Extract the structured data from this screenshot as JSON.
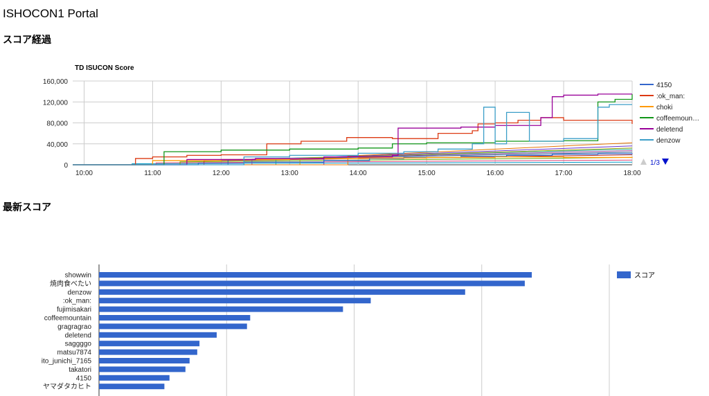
{
  "page": {
    "title": "ISHOCON1 Portal",
    "history_heading": "スコア経過",
    "latest_heading": "最新スコア"
  },
  "chart_data": [
    {
      "type": "line",
      "title": "TD ISUCON Score",
      "x_ticks": [
        "10:00",
        "11:00",
        "12:00",
        "13:00",
        "14:00",
        "15:00",
        "16:00",
        "17:00",
        "18:00"
      ],
      "xlim": [
        "09:50",
        "18:00"
      ],
      "ylim": [
        0,
        160000
      ],
      "y_ticks": [
        0,
        40000,
        80000,
        120000,
        160000
      ],
      "y_tick_labels": [
        "0",
        "40,000",
        "80,000",
        "120,000",
        "160,000"
      ],
      "grid": true,
      "legend_position": "right",
      "legend_page": "1/3",
      "series": [
        {
          "name": "4150",
          "color": "#3366cc",
          "points": [
            [
              "09:50",
              0
            ],
            [
              "11:40",
              0
            ],
            [
              "11:40",
              3000
            ],
            [
              "12:20",
              5000
            ],
            [
              "13:30",
              8000
            ],
            [
              "14:10",
              12000
            ],
            [
              "14:40",
              14000
            ],
            [
              "15:30",
              16000
            ],
            [
              "16:10",
              18000
            ],
            [
              "16:50",
              20000
            ],
            [
              "17:30",
              21000
            ],
            [
              "18:00",
              22000
            ]
          ]
        },
        {
          "name": ":ok_man:",
          "color": "#dc3912",
          "points": [
            [
              "09:50",
              0
            ],
            [
              "10:40",
              0
            ],
            [
              "10:45",
              12000
            ],
            [
              "11:00",
              15000
            ],
            [
              "11:30",
              18000
            ],
            [
              "12:00",
              19000
            ],
            [
              "12:40",
              40000
            ],
            [
              "13:10",
              45000
            ],
            [
              "13:50",
              52000
            ],
            [
              "14:30",
              50000
            ],
            [
              "15:10",
              60000
            ],
            [
              "15:40",
              65000
            ],
            [
              "15:45",
              78000
            ],
            [
              "16:00",
              80000
            ],
            [
              "16:20",
              85000
            ],
            [
              "16:40",
              90000
            ],
            [
              "17:00",
              85000
            ],
            [
              "17:30",
              85000
            ],
            [
              "18:00",
              78000
            ]
          ]
        },
        {
          "name": "choki",
          "color": "#ff9900",
          "points": [
            [
              "09:50",
              0
            ],
            [
              "11:00",
              0
            ],
            [
              "11:00",
              8000
            ],
            [
              "12:00",
              10000
            ],
            [
              "13:00",
              12000
            ],
            [
              "14:00",
              13000
            ],
            [
              "15:00",
              14000
            ],
            [
              "16:00",
              15000
            ],
            [
              "17:00",
              14000
            ],
            [
              "18:00",
              15000
            ]
          ]
        },
        {
          "name": "coffeemountain",
          "color": "#109618",
          "points": [
            [
              "09:50",
              0
            ],
            [
              "11:10",
              0
            ],
            [
              "11:10",
              25000
            ],
            [
              "12:00",
              28000
            ],
            [
              "13:00",
              30000
            ],
            [
              "14:00",
              32000
            ],
            [
              "14:30",
              40000
            ],
            [
              "15:00",
              42000
            ],
            [
              "16:00",
              45000
            ],
            [
              "17:00",
              46000
            ],
            [
              "17:30",
              120000
            ],
            [
              "17:45",
              125000
            ],
            [
              "18:00",
              135000
            ]
          ]
        },
        {
          "name": "deletend",
          "color": "#990099",
          "points": [
            [
              "09:50",
              0
            ],
            [
              "11:30",
              0
            ],
            [
              "11:30",
              10000
            ],
            [
              "12:30",
              12000
            ],
            [
              "13:30",
              15000
            ],
            [
              "14:30",
              18000
            ],
            [
              "14:35",
              70000
            ],
            [
              "15:30",
              72000
            ],
            [
              "16:00",
              75000
            ],
            [
              "16:40",
              90000
            ],
            [
              "16:50",
              130000
            ],
            [
              "17:00",
              133000
            ],
            [
              "17:30",
              135000
            ],
            [
              "18:00",
              135000
            ]
          ]
        },
        {
          "name": "denzow",
          "color": "#3b9ec8",
          "points": [
            [
              "09:50",
              0
            ],
            [
              "12:20",
              0
            ],
            [
              "12:20",
              15000
            ],
            [
              "13:00",
              18000
            ],
            [
              "14:00",
              22000
            ],
            [
              "14:40",
              25000
            ],
            [
              "15:10",
              30000
            ],
            [
              "15:40",
              40000
            ],
            [
              "15:50",
              110000
            ],
            [
              "16:00",
              40000
            ],
            [
              "16:10",
              100000
            ],
            [
              "16:30",
              45000
            ],
            [
              "17:00",
              50000
            ],
            [
              "17:30",
              110000
            ],
            [
              "17:40",
              115000
            ],
            [
              "18:00",
              115000
            ]
          ]
        }
      ],
      "extra_series_colors": [
        "#0099c6",
        "#dd4477",
        "#66aa00",
        "#b82e2e",
        "#316395",
        "#994499",
        "#22aa99",
        "#aaaa11",
        "#6633cc",
        "#e67300"
      ]
    },
    {
      "type": "bar",
      "orientation": "horizontal",
      "xlim": [
        0,
        160000
      ],
      "legend_position": "top-right",
      "series": [
        {
          "name": "スコア",
          "color": "#3366cc"
        }
      ],
      "categories": [
        "showwin",
        "焼肉食べたい",
        "denzow",
        ":ok_man:",
        "fujimisakari",
        "coffeemountain",
        "gragragrao",
        "deletend",
        "saggggo",
        "matsu7874",
        "ito_junichi_7165",
        "takatori",
        "4150",
        "ヤマダタカヒト"
      ],
      "values": [
        135700,
        133500,
        114800,
        85200,
        76500,
        47400,
        46400,
        36900,
        31500,
        30800,
        28400,
        27100,
        22100,
        20500
      ]
    }
  ]
}
